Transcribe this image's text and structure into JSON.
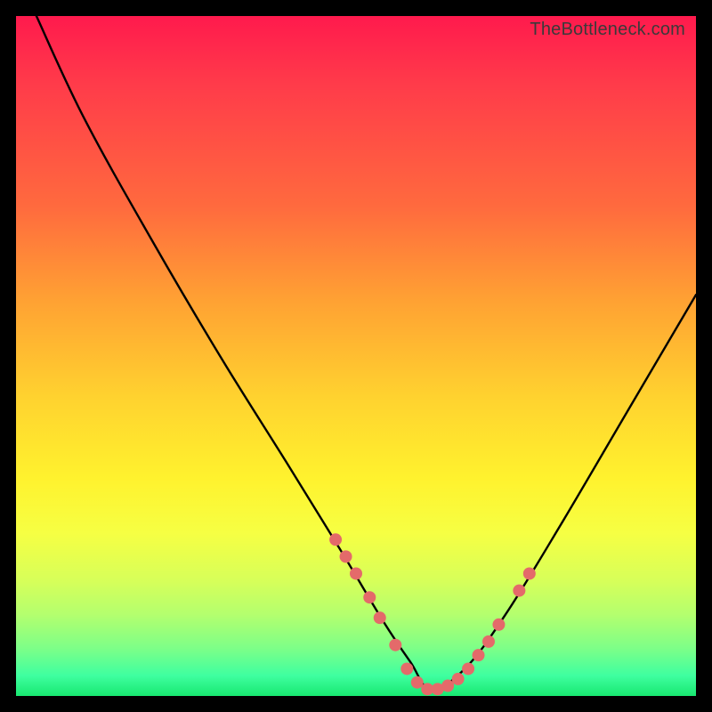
{
  "watermark": "TheBottleneck.com",
  "chart_data": {
    "type": "line",
    "title": "",
    "xlabel": "",
    "ylabel": "",
    "xlim": [
      0,
      100
    ],
    "ylim": [
      0,
      100
    ],
    "grid": false,
    "legend": false,
    "description": "V-shaped bottleneck curve over a red-to-green vertical gradient. Lower y (closer to bottom/green) indicates less bottleneck. The minimum is ~x=61. Salmon dots highlight points near the optimal zone.",
    "series": [
      {
        "name": "curve",
        "color": "#000000",
        "x": [
          3,
          10,
          20,
          30,
          40,
          48,
          54,
          58,
          61,
          66,
          72,
          80,
          90,
          100
        ],
        "y": [
          100,
          85,
          67,
          50,
          34,
          21,
          11,
          5,
          1,
          4,
          12,
          25,
          42,
          59
        ]
      }
    ],
    "markers": {
      "name": "optimal-points",
      "color": "#e46a6a",
      "radius_px": 7,
      "points": [
        {
          "x": 47.0,
          "y": 23.0
        },
        {
          "x": 48.5,
          "y": 20.5
        },
        {
          "x": 50.0,
          "y": 18.0
        },
        {
          "x": 52.0,
          "y": 14.5
        },
        {
          "x": 53.5,
          "y": 11.5
        },
        {
          "x": 55.8,
          "y": 7.5
        },
        {
          "x": 57.5,
          "y": 4.0
        },
        {
          "x": 59.0,
          "y": 2.0
        },
        {
          "x": 60.5,
          "y": 1.0
        },
        {
          "x": 62.0,
          "y": 1.0
        },
        {
          "x": 63.5,
          "y": 1.5
        },
        {
          "x": 65.0,
          "y": 2.5
        },
        {
          "x": 66.5,
          "y": 4.0
        },
        {
          "x": 68.0,
          "y": 6.0
        },
        {
          "x": 69.5,
          "y": 8.0
        },
        {
          "x": 71.0,
          "y": 10.5
        },
        {
          "x": 74.0,
          "y": 15.5
        },
        {
          "x": 75.5,
          "y": 18.0
        }
      ]
    }
  }
}
